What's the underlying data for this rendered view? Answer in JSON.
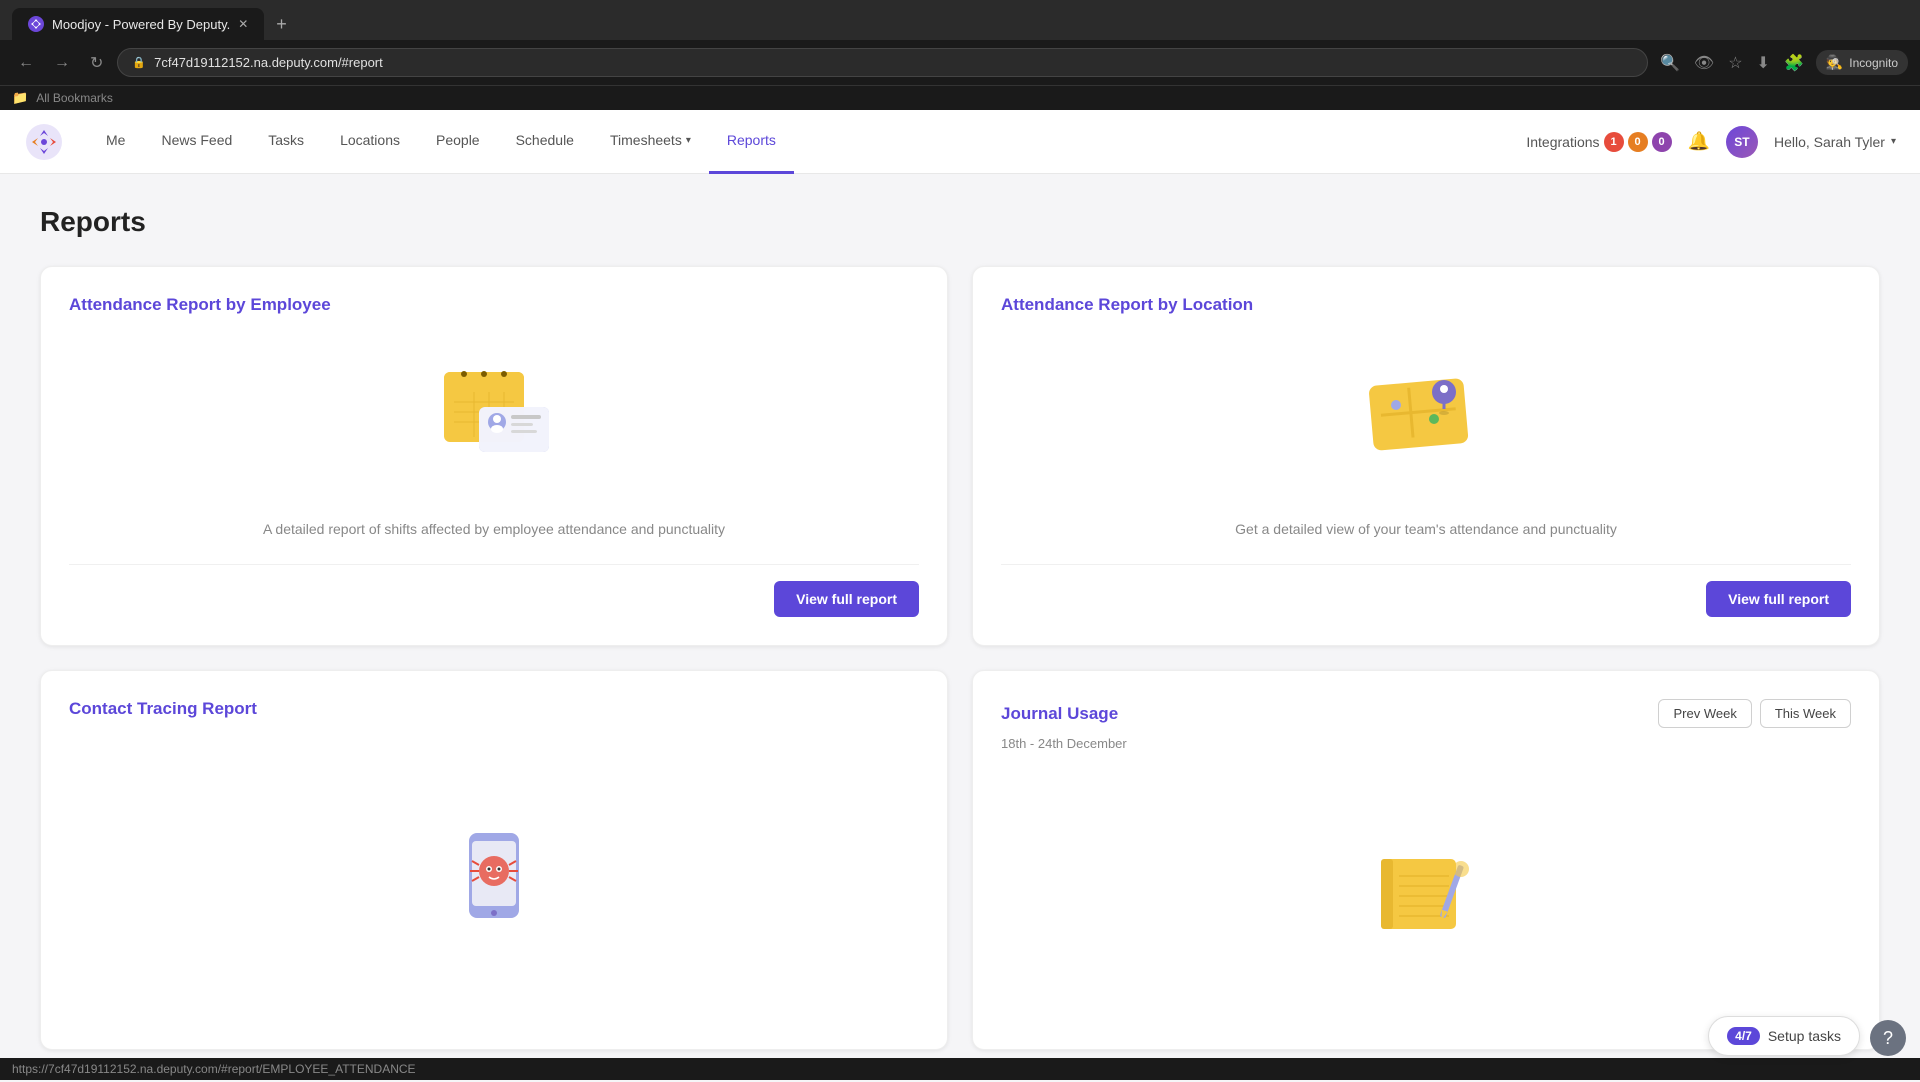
{
  "browser": {
    "tab_title": "Moodjoy - Powered By Deputy.",
    "url": "7cf47d19112152.na.deputy.com/#report",
    "status_url": "https://7cf47d19112152.na.deputy.com/#report/EMPLOYEE_ATTENDANCE",
    "incognito_label": "Incognito",
    "bookmarks_label": "All Bookmarks",
    "new_tab": "+"
  },
  "nav": {
    "logo_alt": "Deputy Logo",
    "items": [
      {
        "label": "Me",
        "active": false
      },
      {
        "label": "News Feed",
        "active": false
      },
      {
        "label": "Tasks",
        "active": false
      },
      {
        "label": "Locations",
        "active": false
      },
      {
        "label": "People",
        "active": false
      },
      {
        "label": "Schedule",
        "active": false
      },
      {
        "label": "Timesheets",
        "active": false,
        "dropdown": true
      },
      {
        "label": "Reports",
        "active": true
      }
    ],
    "integrations_label": "Integrations",
    "integration_dots": [
      "1",
      "0",
      "0"
    ],
    "user_greeting": "Hello, Sarah Tyler",
    "user_initials": "ST"
  },
  "page": {
    "title": "Reports"
  },
  "reports": [
    {
      "id": "employee-attendance",
      "title": "Attendance Report by Employee",
      "description": "A detailed report of shifts affected by employee attendance and punctuality",
      "btn_label": "View full report",
      "has_footer_btn": true
    },
    {
      "id": "location-attendance",
      "title": "Attendance Report by Location",
      "description": "Get a detailed view of your team's attendance and punctuality",
      "btn_label": "View full report",
      "has_footer_btn": true
    },
    {
      "id": "contact-tracing",
      "title": "Contact Tracing Report",
      "description": "",
      "btn_label": "",
      "has_footer_btn": false
    },
    {
      "id": "journal-usage",
      "title": "Journal Usage",
      "description": "",
      "week_range": "18th - 24th December",
      "btn_prev": "Prev Week",
      "btn_this": "This Week",
      "has_footer_btn": false
    }
  ],
  "setup_tasks": {
    "label": "Setup tasks",
    "badge": "4/7"
  },
  "help": {
    "label": "?"
  }
}
